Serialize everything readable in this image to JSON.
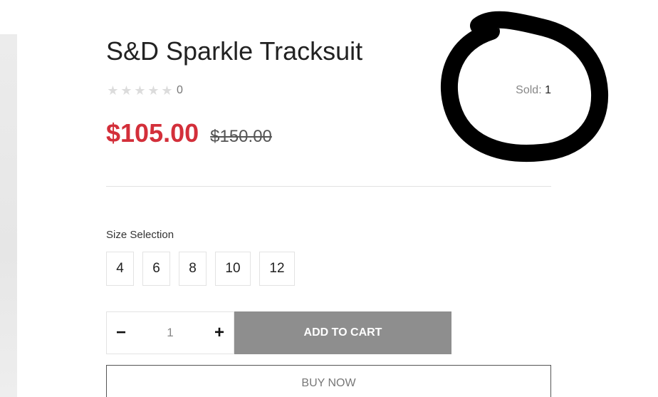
{
  "product": {
    "title": "S&D Sparkle Tracksuit",
    "rating": {
      "stars_filled": 0,
      "stars_total": 5,
      "review_count": "0"
    },
    "sold": {
      "label": "Sold: ",
      "value": "1"
    },
    "price": "$105.00",
    "compare_price": "$150.00"
  },
  "size_selection": {
    "label": "Size Selection",
    "options": [
      "4",
      "6",
      "8",
      "10",
      "12"
    ]
  },
  "purchase": {
    "decrement_label": "−",
    "quantity": "1",
    "increment_label": "+",
    "add_to_cart_label": "ADD TO CART",
    "buy_now_label": "BUY NOW"
  },
  "colors": {
    "price": "#d32f3a",
    "add_to_cart_bg": "#8e8e8e",
    "star_empty": "#dcdcdc",
    "annotation_ink": "#000000"
  },
  "icons": {
    "star": "star-outline-icon",
    "annotation": "hand-drawn-circle"
  }
}
